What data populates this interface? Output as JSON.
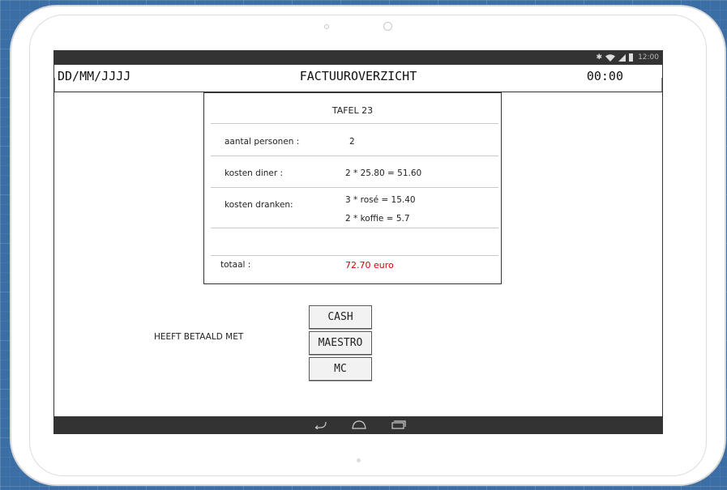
{
  "status_bar": {
    "time": "12:00",
    "icons": [
      "bluetooth-icon",
      "wifi-icon",
      "signal-icon",
      "battery-icon"
    ]
  },
  "header": {
    "date": "DD/MM/JJJJ",
    "title": "FACTUUROVERZICHT",
    "time": "00:00"
  },
  "invoice": {
    "table": "TAFEL 23",
    "rows": [
      {
        "label": "aantal personen :",
        "values": [
          "2"
        ]
      },
      {
        "label": "kosten diner :",
        "values": [
          "2 * 25.80 = 51.60"
        ]
      },
      {
        "label": "kosten dranken:",
        "values": [
          "3 * rosé  = 15.40",
          "2 * koffie = 5.7"
        ]
      }
    ],
    "total_label": "totaal :",
    "total_value": "72.70 euro"
  },
  "payment": {
    "label": "HEEFT BETAALD MET",
    "buttons": [
      "CASH",
      "MAESTRO",
      "MC"
    ]
  },
  "nav": {
    "icons": [
      "back-icon",
      "home-icon",
      "recent-apps-icon"
    ]
  },
  "colors": {
    "background": "#3a6ea5",
    "bars": "#333333",
    "total": "#dd0000"
  }
}
